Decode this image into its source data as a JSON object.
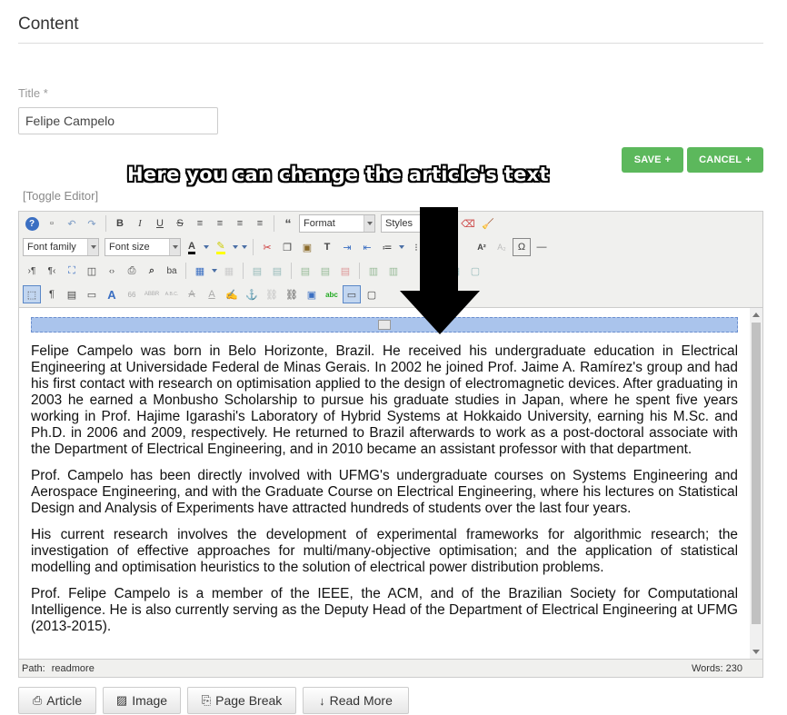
{
  "section": {
    "title": "Content"
  },
  "title_field": {
    "label": "Title *",
    "value": "Felipe Campelo"
  },
  "actions": {
    "save_label": "SAVE",
    "save_icon": "+",
    "cancel_label": "CANCEL",
    "cancel_icon": "+"
  },
  "annotation": {
    "text": "Here you can change the article's text"
  },
  "editor": {
    "toggle_label": "[Toggle Editor]",
    "toolbar": {
      "format_select": "Format",
      "styles_select": "Styles",
      "font_family_select": "Font family",
      "font_size_select": "Font size",
      "icons": {
        "help": "?",
        "new_document": "▫",
        "undo": "↶",
        "redo": "↷",
        "bold": "B",
        "italic": "I",
        "underline": "U",
        "strikethrough": "S",
        "align_justify": "≡",
        "align_center": "≡",
        "align_left": "≡",
        "align_right": "≡",
        "blockquote": "“",
        "font_color": "A",
        "highlight": "✎",
        "cut": "✂",
        "copy": "❐",
        "paste": "▣",
        "paste_text": "T",
        "indent": "⇥",
        "outdent": "⇤",
        "ordered_list": "≔",
        "unordered_list": "⁝",
        "superscript": "A²",
        "subscript": "A₂",
        "omega": "Ω",
        "horizontal_rule": "—",
        "ltr": "›¶",
        "rtl": "¶‹",
        "fullscreen": "⛶",
        "preview": "◫",
        "code": "‹›",
        "print": "⎙",
        "find": "⌕",
        "replace": "ba",
        "table": "▦",
        "visual_aid": "⬚",
        "show_blocks": "¶",
        "template": "▤",
        "image_upload": "▭",
        "styles_text": "A",
        "cite": "66",
        "abbr": "ABBR",
        "acronym": "A.B.C.",
        "del": "A",
        "ins": "A",
        "attributes": "✍",
        "anchor": "⚓",
        "unlink": "⛓",
        "link": "⛓",
        "image": "▣",
        "spellcheck": "abc",
        "pagebreak": "▭",
        "layer": "▢"
      }
    },
    "paragraphs": [
      "Felipe Campelo was born in Belo Horizonte, Brazil. He received his undergraduate education in Electrical Engineering at Universidade Federal de Minas Gerais. In 2002 he joined Prof. Jaime A. Ramírez's group and had his first contact with research on optimisation applied to the design of electromagnetic devices. After graduating in 2003 he earned a Monbusho Scholarship to pursue his graduate studies in Japan, where he spent five years working in Prof. Hajime Igarashi's Laboratory of Hybrid Systems at Hokkaido University, earning his M.Sc. and Ph.D. in 2006 and 2009, respectively. He returned to Brazil afterwards to work as a post-doctoral associate with the Department of Electrical Engineering, and in 2010 became an assistant professor with that department.",
      "Prof. Campelo has been directly involved with UFMG's undergraduate courses on Systems Engineering and Aerospace Engineering, and with the Graduate Course on Electrical Engineering, where his lectures on Statistical Design and Analysis of Experiments have attracted hundreds of students over the last four years.",
      "His current research involves the development of experimental frameworks for algorithmic research; the investigation of effective approaches for multi/many-objective optimisation; and the application of statistical modelling and optimisation heuristics to the solution of electrical power distribution problems.",
      "Prof. Felipe Campelo is a member of the IEEE, the ACM, and of the Brazilian Society for Computational Intelligence. He is also currently serving as the Deputy Head of the Department of Electrical Engineering at UFMG (2013-2015)."
    ],
    "status": {
      "path_label": "Path:",
      "path_value": "readmore",
      "words_label": "Words:",
      "words_count": "230"
    }
  },
  "bottom_buttons": [
    {
      "label": "Article",
      "icon": "📄"
    },
    {
      "label": "Image",
      "icon": "🖼"
    },
    {
      "label": "Page Break",
      "icon": "⎘"
    },
    {
      "label": "Read More",
      "icon": "↓"
    }
  ],
  "colors": {
    "green": "#5cb85c",
    "readmore_bar": "#aac4ec",
    "toolbar_bg": "#f0f0ee"
  }
}
